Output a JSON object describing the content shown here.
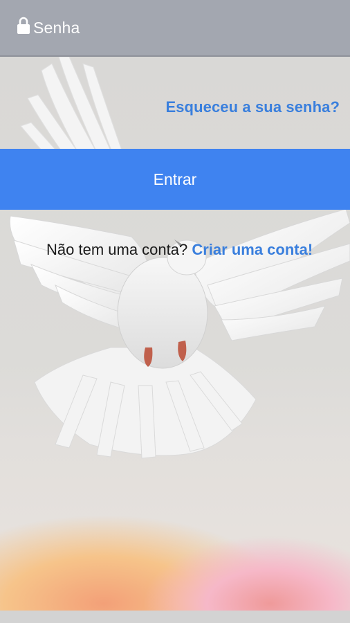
{
  "password_field": {
    "placeholder": "Senha",
    "icon": "lock-icon"
  },
  "forgot_password": {
    "label": "Esqueceu a sua senha?"
  },
  "login_button": {
    "label": "Entrar"
  },
  "signup": {
    "prompt": "Não tem uma conta?",
    "link_label": "Criar uma conta!"
  },
  "colors": {
    "primary": "#3f83f0",
    "link": "#3a7fdd",
    "field_bg": "#a3a7b0"
  }
}
